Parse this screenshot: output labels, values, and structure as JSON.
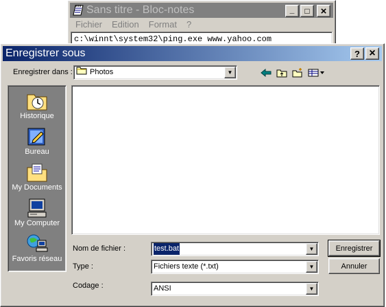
{
  "notepad": {
    "title": "Sans titre - Bloc-notes",
    "menu": [
      "Fichier",
      "Edition",
      "Format",
      "?"
    ],
    "content": "c:\\winnt\\system32\\ping.exe www.yahoo.com",
    "buttons": {
      "minimize": "_",
      "maximize": "□",
      "close": "×"
    }
  },
  "dialog": {
    "title": "Enregistrer sous",
    "help_button": "?",
    "close_button": "×",
    "save_in_label": "Enregistrer dans :",
    "save_in_value": "Photos",
    "places": [
      {
        "label": "Historique",
        "icon": "history-icon"
      },
      {
        "label": "Bureau",
        "icon": "desktop-icon"
      },
      {
        "label": "My Documents",
        "icon": "my-documents-icon"
      },
      {
        "label": "My Computer",
        "icon": "my-computer-icon"
      },
      {
        "label": "Favoris réseau",
        "icon": "network-places-icon"
      }
    ],
    "filename_label": "Nom de fichier :",
    "filename_value": "test.bat",
    "type_label": "Type :",
    "type_value": "Fichiers texte (*.txt)",
    "encoding_label": "Codage :",
    "encoding_value": "ANSI",
    "save_button": "Enregistrer",
    "cancel_button": "Annuler"
  },
  "colors": {
    "title_active_start": "#0a246a",
    "title_active_end": "#a6caf0",
    "title_inactive": "#808080",
    "face": "#d4d0c8"
  }
}
